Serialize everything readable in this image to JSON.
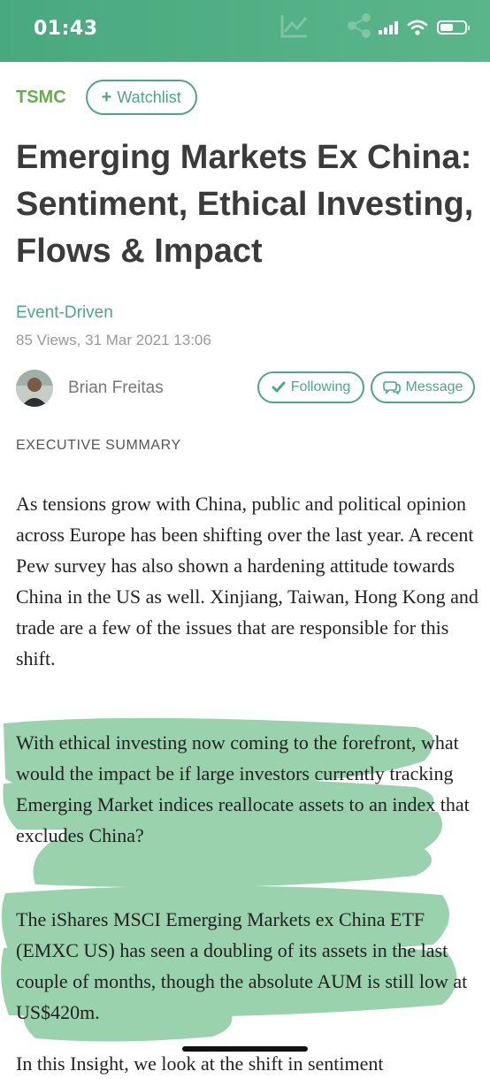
{
  "status_bar": {
    "time": "01:43",
    "signal_icon": "signal-bars-icon",
    "wifi_icon": "wifi-icon",
    "battery_icon": "battery-icon",
    "background": "#4faf84"
  },
  "article": {
    "ticker": "TSMC",
    "watchlist_label": "Watchlist",
    "title": "Emerging Markets Ex China: Sentiment, Ethical Investing, Flows & Impact",
    "category": "Event-Driven",
    "meta": "85 Views, 31 Mar 2021 13:06",
    "author": "Brian Freitas",
    "following_label": "Following",
    "message_label": "Message",
    "section_label": "EXECUTIVE SUMMARY",
    "paragraphs": [
      "As tensions grow with China, public and political opinion across Europe has been shifting over the last year. A recent Pew survey has also shown a hardening attitude towards China in the US as well. Xinjiang, Taiwan, Hong Kong and trade are a few of the issues that are responsible for this shift.",
      "With ethical investing now coming to the forefront, what would the impact be if large investors currently tracking Emerging Market indices reallocate assets to an index that excludes China?",
      "The iShares MSCI Emerging Markets ex China ETF (EMXC US) has seen a doubling of its assets in the last couple of months, though the absolute AUM is still low at US$420m.",
      "In this Insight, we look at the shift in sentiment"
    ]
  },
  "colors": {
    "accent": "#4ea68a",
    "ticker": "#6aab4e",
    "highlight": "#5cb87a"
  }
}
